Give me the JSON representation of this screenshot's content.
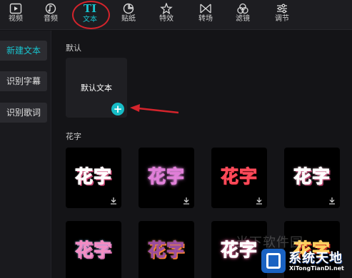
{
  "toolbar": {
    "tabs": [
      {
        "label": "视频",
        "icon": "video-icon"
      },
      {
        "label": "音频",
        "icon": "music-icon"
      },
      {
        "label": "文本",
        "icon": "text-icon",
        "active": true
      },
      {
        "label": "贴纸",
        "icon": "sticker-icon"
      },
      {
        "label": "特效",
        "icon": "effects-icon"
      },
      {
        "label": "转场",
        "icon": "transition-icon"
      },
      {
        "label": "滤镜",
        "icon": "filter-icon"
      },
      {
        "label": "调节",
        "icon": "adjust-icon"
      }
    ],
    "text_tab_glyph": "TI"
  },
  "sidebar": {
    "items": [
      {
        "label": "新建文本",
        "active": true
      },
      {
        "label": "识别字幕"
      },
      {
        "label": "识别歌词"
      }
    ]
  },
  "sections": {
    "default_label": "默认",
    "default_card_text": "默认文本",
    "huazi_label": "花字"
  },
  "huazi_tiles": [
    {
      "text": "花字"
    },
    {
      "text": "花字"
    },
    {
      "text": "花字"
    },
    {
      "text": "花字"
    },
    {
      "text": "花字"
    },
    {
      "text": "花字"
    },
    {
      "text": "花字"
    },
    {
      "text": "花字"
    }
  ],
  "watermark": {
    "faint_text": "当下软件园",
    "brand": "系统天地",
    "url": "XiTongTianDi.net"
  },
  "colors": {
    "accent": "#18c4cf",
    "annotation_red": "#d4242c",
    "background": "#141417"
  }
}
